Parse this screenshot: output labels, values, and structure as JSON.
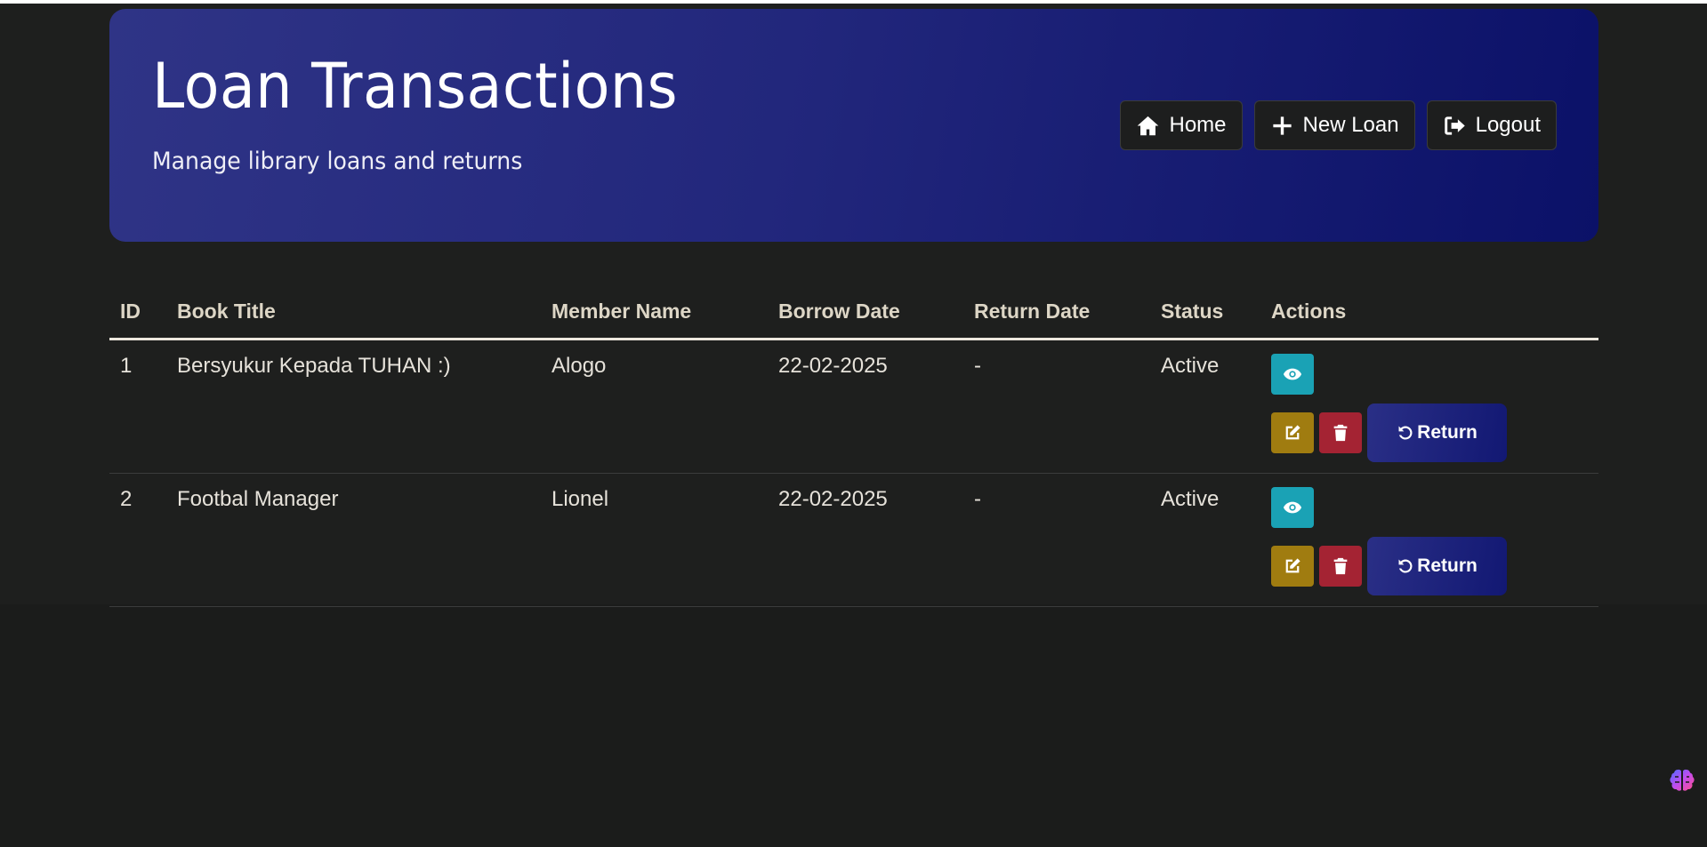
{
  "header": {
    "title": "Loan Transactions",
    "subtitle": "Manage library loans and returns",
    "nav": [
      {
        "label": "Home",
        "icon": "home-icon"
      },
      {
        "label": "New Loan",
        "icon": "plus-icon"
      },
      {
        "label": "Logout",
        "icon": "logout-icon"
      }
    ]
  },
  "table": {
    "columns": [
      "ID",
      "Book Title",
      "Member Name",
      "Borrow Date",
      "Return Date",
      "Status",
      "Actions"
    ],
    "rows": [
      {
        "id": "1",
        "book_title": "Bersyukur Kepada TUHAN :)",
        "member_name": "Alogo",
        "borrow_date": "22-02-2025",
        "return_date": "-",
        "status": "Active",
        "return_label": "Return"
      },
      {
        "id": "2",
        "book_title": "Footbal Manager",
        "member_name": "Lionel",
        "borrow_date": "22-02-2025",
        "return_date": "-",
        "status": "Active",
        "return_label": "Return"
      }
    ]
  },
  "colors": {
    "background": "#1b1c1b",
    "header_gradient_start": "#2f3486",
    "header_gradient_end": "#0b1168",
    "view_button": "#1aa2b5",
    "edit_button": "#a07c10",
    "delete_button": "#a42333",
    "return_button": "#1c2179"
  }
}
